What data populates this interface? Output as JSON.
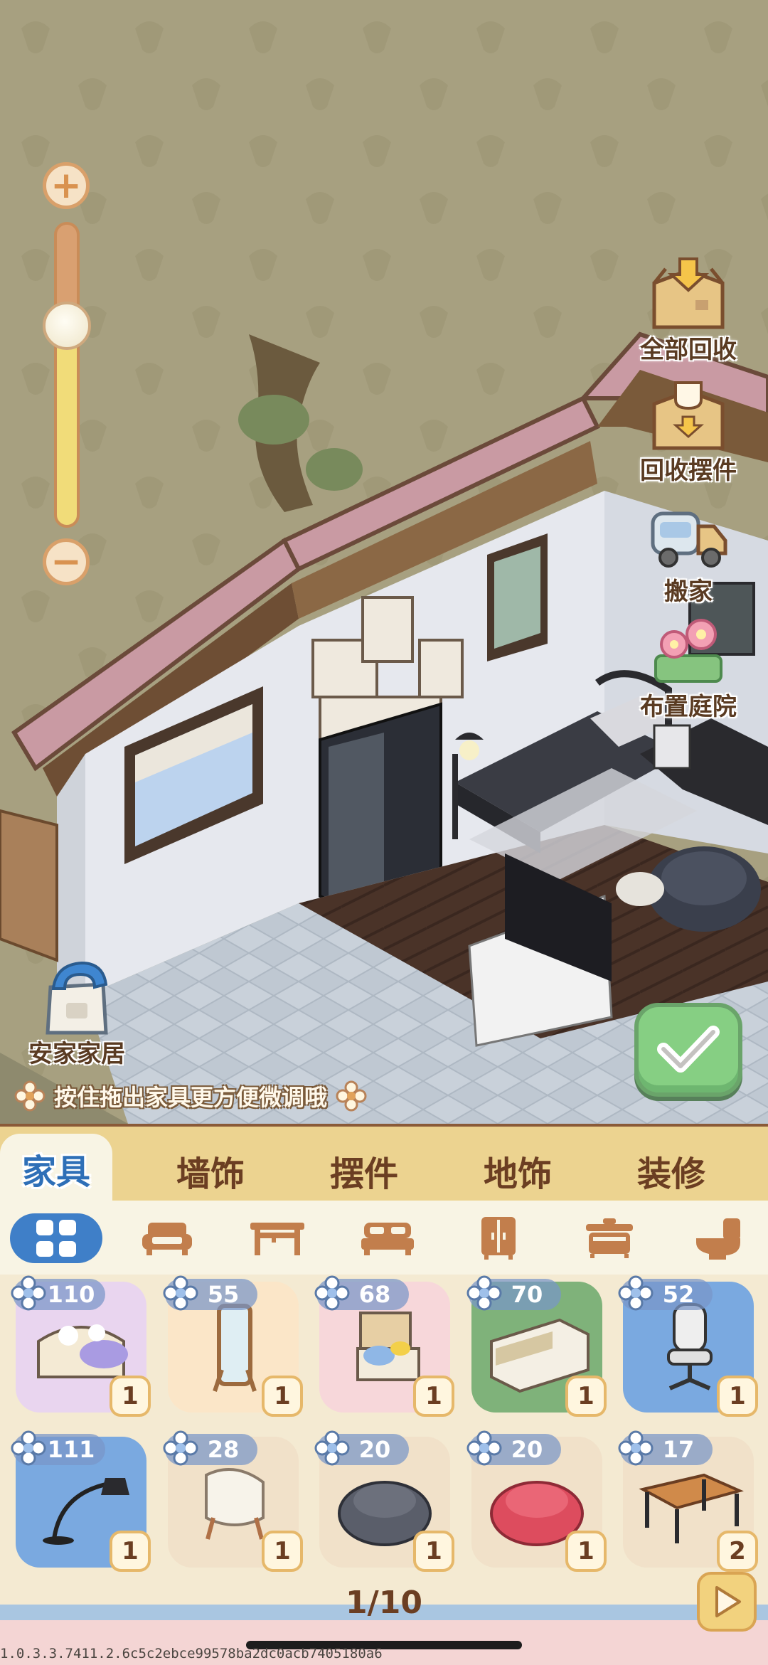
{
  "zoom": {
    "in_label": "+",
    "out_label": "−",
    "level": 0.34
  },
  "side_actions": [
    {
      "label": "全部回收",
      "icon": "box-down-arrow-icon"
    },
    {
      "label": "回收摆件",
      "icon": "box-cup-icon"
    },
    {
      "label": "搬家",
      "icon": "moving-truck-icon"
    },
    {
      "label": "布置庭院",
      "icon": "garden-flowers-icon"
    }
  ],
  "home": {
    "label": "安家家居",
    "icon": "shopping-bag-icon"
  },
  "hint": "按住拖出家具更方便微调哦",
  "confirm_icon": "checkmark-icon",
  "tabs": [
    "家具",
    "墙饰",
    "摆件",
    "地饰",
    "装修"
  ],
  "active_tab": 0,
  "categories": [
    "all-grid-icon",
    "sofa-icon",
    "table-icon",
    "bed-icon",
    "wardrobe-icon",
    "cabinet-icon",
    "toilet-icon"
  ],
  "active_category": 0,
  "items": [
    {
      "name": "cat-sofa",
      "price": "110",
      "qty": "1",
      "bg": "#e9d5ef"
    },
    {
      "name": "standing-mirror",
      "price": "55",
      "qty": "1",
      "bg": "#fbe6c8"
    },
    {
      "name": "reading-chair",
      "price": "68",
      "qty": "1",
      "bg": "#f7d7da"
    },
    {
      "name": "tv-cabinet",
      "price": "70",
      "qty": "1",
      "bg": "#7fb27a"
    },
    {
      "name": "gaming-chair",
      "price": "52",
      "qty": "1",
      "bg": "#7aa9e0"
    },
    {
      "name": "floor-lamp",
      "price": "111",
      "qty": "1",
      "bg": "#7aa9e0"
    },
    {
      "name": "fluffy-chair",
      "price": "28",
      "qty": "1",
      "bg": "#f1e1c9"
    },
    {
      "name": "grey-beanbag",
      "price": "20",
      "qty": "1",
      "bg": "#f1e1c9"
    },
    {
      "name": "red-beanbag",
      "price": "20",
      "qty": "1",
      "bg": "#f1e1c9"
    },
    {
      "name": "wooden-table",
      "price": "17",
      "qty": "2",
      "bg": "#f1e1c9"
    }
  ],
  "pager": "1/10",
  "build_id": "1.0.3.3.7411.2.6c5c2ebce99578ba2dc0acb7405180a6"
}
